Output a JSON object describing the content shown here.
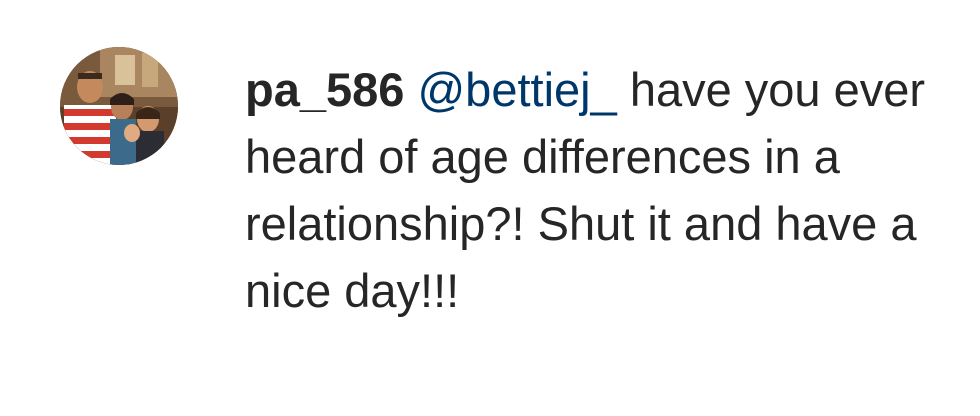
{
  "comment": {
    "username": "pa_586",
    "mention": "@bettiej_",
    "text": "have you ever heard of age differences in a relationship?! Shut it and have a nice day!!!"
  },
  "colors": {
    "text": "#262626",
    "mention": "#00376b",
    "background": "#ffffff"
  },
  "icons": {
    "avatar": "profile-photo-avatar"
  }
}
